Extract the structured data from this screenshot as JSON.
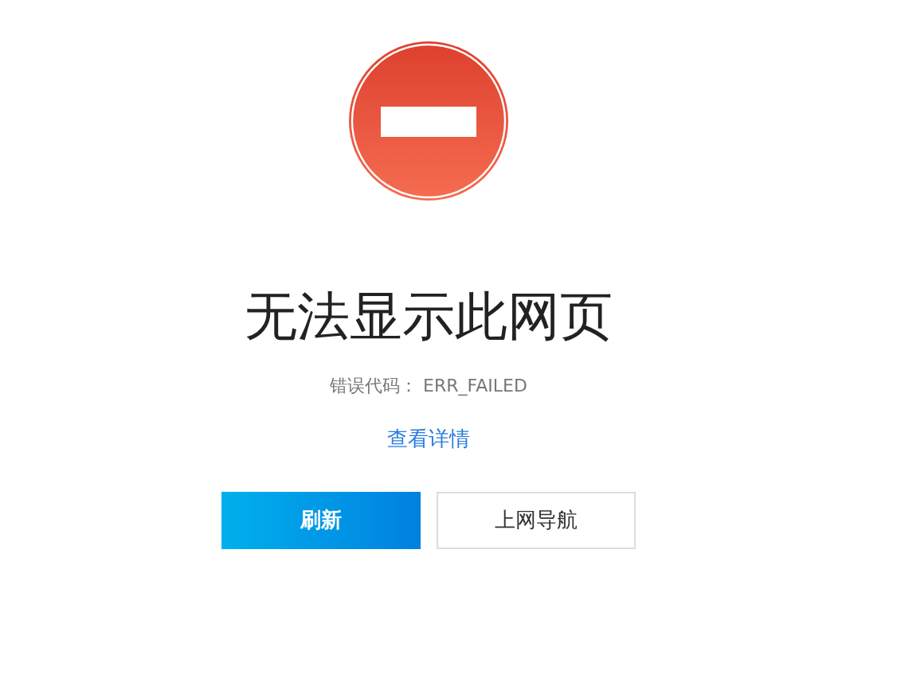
{
  "title": "无法显示此网页",
  "error_code": "错误代码： ERR_FAILED",
  "details_link": "查看详情",
  "buttons": [
    {
      "label": "刷新",
      "kind": "primary"
    },
    {
      "label": "上网导航",
      "kind": "secondary"
    }
  ]
}
